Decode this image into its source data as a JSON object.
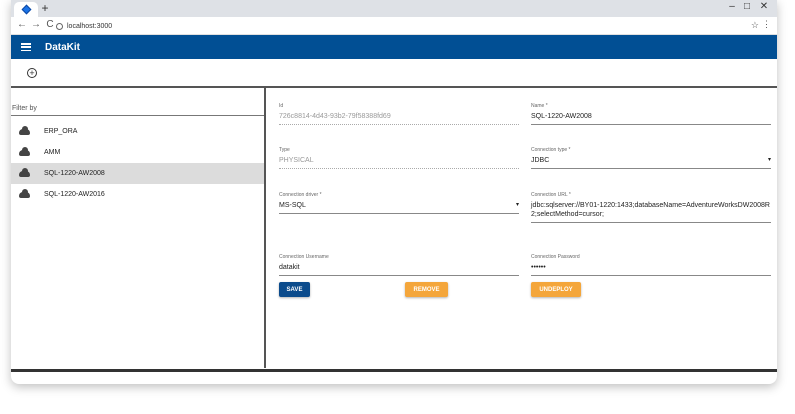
{
  "browser": {
    "new_tab": "+",
    "url": "localhost:3000",
    "win_min": "–",
    "win_max": "□",
    "win_close": "✕",
    "back": "←",
    "forward": "→",
    "reload": "C",
    "star": "☆",
    "menu": "⋮"
  },
  "app": {
    "title": "DataKit",
    "add": "+"
  },
  "sidebar": {
    "filter_label": "Filter by",
    "items": [
      "ERP_ORA",
      "AMM",
      "SQL-1220-AW2008",
      "SQL-1220-AW2016"
    ],
    "selected_index": 2
  },
  "form": {
    "id_label": "Id",
    "id_value": "726c8814-4d43-93b2-79f58388fd69",
    "name_label": "Name *",
    "name_value": "SQL-1220-AW2008",
    "type_label": "Type",
    "type_value": "PHYSICAL",
    "conn_type_label": "Connection type *",
    "conn_type_value": "JDBC",
    "driver_label": "Connection driver *",
    "driver_value": "MS-SQL",
    "url_label": "Connection URL *",
    "url_value": "jdbc:sqlserver://BY01-1220:1433;databaseName=AdventureWorksDW2008R2;selectMethod=cursor;",
    "username_label": "Connection Username",
    "username_value": "datakit",
    "password_label": "Connection Password",
    "password_value": "••••••",
    "caret": "▾"
  },
  "buttons": {
    "save": "SAVE",
    "remove": "REMOVE",
    "undeploy": "UNDEPLOY"
  },
  "colors": {
    "appbar": "#014f94",
    "save": "#0b4b8c",
    "orange": "#f4a63b"
  }
}
